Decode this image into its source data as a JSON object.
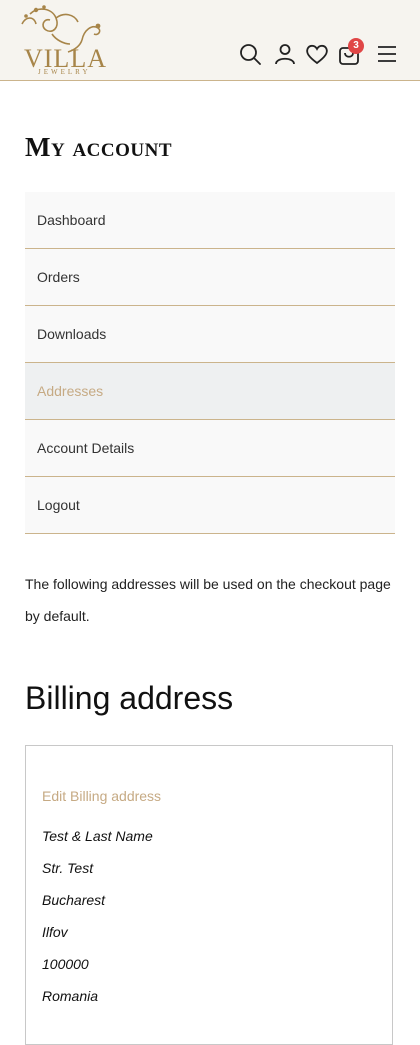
{
  "header": {
    "logo_text": "VILLA",
    "logo_subtext": "JEWELRY",
    "icons": [
      "search-icon",
      "user-icon",
      "heart-icon",
      "bag-icon",
      "hamburger-menu-icon"
    ],
    "cart_count": "3",
    "accent_color": "#a78549",
    "badge_color": "#e04646"
  },
  "page_title": "My account",
  "nav": {
    "items": [
      {
        "label": "Dashboard"
      },
      {
        "label": "Orders"
      },
      {
        "label": "Downloads"
      },
      {
        "label": "Addresses",
        "active": true
      },
      {
        "label": "Account Details"
      },
      {
        "label": "Logout"
      }
    ],
    "active_color": "#c6aa84"
  },
  "intro_text": "The following addresses will be used on the checkout page by default.",
  "billing": {
    "title": "Billing address",
    "edit_label": "Edit Billing address",
    "lines": [
      "Test & Last Name",
      "Str. Test",
      "Bucharest",
      "Ilfov",
      "100000",
      "Romania"
    ]
  }
}
